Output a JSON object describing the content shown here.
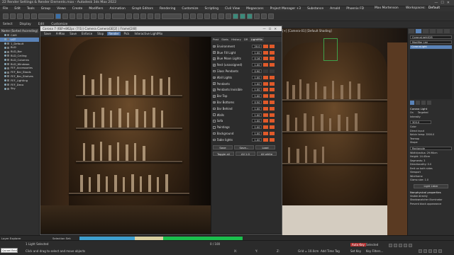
{
  "window": {
    "title": "22 Render Settings & Render Elements.max - Autodesk 3ds Max 2022"
  },
  "menubar": {
    "items": [
      "File",
      "Edit",
      "Tools",
      "Group",
      "Views",
      "Create",
      "Modifiers",
      "Animation",
      "Graph Editors",
      "Rendering",
      "Customize",
      "Scripting",
      "Civil View",
      "Megascans",
      "Project Manager +3",
      "Substance",
      "Arnold",
      "Phoenix FD"
    ],
    "workspace_user": "Max Mortenson",
    "workspaces_label": "Workspaces:",
    "workspace_value": "Default"
  },
  "toolbar2": {
    "items": [
      "Select",
      "Display",
      "Edit",
      "Customize"
    ]
  },
  "explorer": {
    "header": "Name (Sorted Ascending)",
    "items": [
      {
        "label": "CAM",
        "child": true,
        "selected": false
      },
      {
        "label": "LGT",
        "child": true,
        "selected": true
      },
      {
        "label": "1_Default",
        "child": true,
        "selected": false
      },
      {
        "label": "BLD",
        "child": true,
        "selected": false
      },
      {
        "label": "BLD_Bar",
        "child": true,
        "selected": false
      },
      {
        "label": "BLD_Ceiling",
        "child": true,
        "selected": false
      },
      {
        "label": "BLD_Columns",
        "child": true,
        "selected": false
      },
      {
        "label": "BLD_Windows",
        "child": true,
        "selected": false
      },
      {
        "label": "FEF_Accessories",
        "child": true,
        "selected": false
      },
      {
        "label": "FEF_Bar_Stools",
        "child": true,
        "selected": false
      },
      {
        "label": "FEF_Bar_Shelves",
        "child": true,
        "selected": false
      },
      {
        "label": "FEF_Lighting",
        "child": true,
        "selected": false
      },
      {
        "label": "FEF_Deco",
        "child": true,
        "selected": false
      },
      {
        "label": "Sky",
        "child": true,
        "selected": false
      }
    ]
  },
  "viewport": {
    "label": "[+] [Camera-01] [Default Shading]"
  },
  "framebuffer": {
    "title": "Corona 7 (6Ef+862pc (7/1)) Camera CameraGE[2] | Frame[2/8]",
    "tools": [
      "Save",
      "A-Max",
      "Save",
      "Enforce",
      "Stop",
      "Render",
      "Pick",
      "Interactive LightMix"
    ],
    "active_tool": "Render",
    "tabs": [
      "Post",
      "Stats",
      "History",
      "DR",
      "LightMix"
    ],
    "active_tab": "LightMix",
    "lightmix": [
      {
        "name": "Environment",
        "checked": true,
        "value": "20.0",
        "swatch": "on"
      },
      {
        "name": "Blue Fill Light",
        "checked": true,
        "value": "1.00",
        "swatch": "on"
      },
      {
        "name": "Blue Moon Lights",
        "checked": true,
        "value": "0.16",
        "swatch": "on"
      },
      {
        "name": "Rest (unassigned)",
        "checked": true,
        "value": "1.00",
        "swatch": "on"
      },
      {
        "name": "Glass Pendants",
        "checked": false,
        "value": "0.90",
        "swatch": "k"
      },
      {
        "name": "Wall Lights",
        "checked": true,
        "value": "1.00",
        "swatch": "on"
      },
      {
        "name": "Pendants",
        "checked": true,
        "value": "1.00",
        "swatch": "on"
      },
      {
        "name": "Pendants Invisible",
        "checked": true,
        "value": "1.00",
        "swatch": "on"
      },
      {
        "name": "Bar Top",
        "checked": true,
        "value": "1.00",
        "swatch": "on"
      },
      {
        "name": "Bar Bottoms",
        "checked": true,
        "value": "0.50",
        "swatch": "on"
      },
      {
        "name": "Bar Behind",
        "checked": false,
        "value": "1.00",
        "swatch": "on"
      },
      {
        "name": "Walls",
        "checked": false,
        "value": "1.00",
        "swatch": "on"
      },
      {
        "name": "Sofa",
        "checked": false,
        "value": "1.00",
        "swatch": "on"
      },
      {
        "name": "Paintings",
        "checked": false,
        "value": "1.00",
        "swatch": "on"
      },
      {
        "name": "Background",
        "checked": false,
        "value": "1.00",
        "swatch": "on"
      },
      {
        "name": "Table lights",
        "checked": false,
        "value": "1.00",
        "swatch": "on"
      }
    ],
    "save_row": [
      "Save",
      "Save...",
      "Load"
    ],
    "bottom_row": [
      "Toggle all",
      "All 1.0",
      "All white"
    ]
  },
  "cmdpanel": {
    "name_field": "CoronaLight028",
    "modifier_list": "Modifier List",
    "stack_item": "CoronaLight",
    "section_title": "Corona Light",
    "on_label": "On",
    "targeted_label": "Targeted",
    "intensity_label": "Intensity",
    "intensity_value": "300.0",
    "color_label": "Color",
    "direct_input": "Direct input",
    "kelvin_temp": "Kelvin temp: 3500.0",
    "texmap": "Texmap",
    "shape_label": "Shape",
    "shape_value": "Rectangle",
    "width_label": "Width/radius: 29.96cm",
    "height_label": "Height: 14.45cm",
    "segments": "Segments: 3",
    "directionality": "Directionality: 0.0",
    "emit_both": "Emit on both sides",
    "viewport_label": "Viewport",
    "wireframe": "Wireframe",
    "gizmo_size": "Gizmo size: 1.0",
    "light_lister": "Light Lister",
    "nonphysical": "Nonphysical properties",
    "visible_directly": "Visible directly",
    "shadowcatcher": "Shadowcatcher illuminator",
    "prevent_black": "Prevent black appearance"
  },
  "status": {
    "selection": "1 Light Selected",
    "hint": "Click and drag to select and move objects",
    "maxscript": "Quixel Bridge",
    "layer_explorer": "Layer Explorer",
    "selection_set": "Selection Set:",
    "frame_counter": "0 / 100",
    "add_time_tag": "Add Time Tag",
    "autokey": "Auto Key",
    "selected": "Selected",
    "setkey": "Set Key",
    "key_filters": "Key Filters...",
    "x_label": "X:",
    "y_label": "Y:",
    "z_label": "Z:",
    "grid": "Grid = 10.0cm"
  },
  "colors": {
    "accent": "#5a83b8",
    "lightmix_swatch": "#e05a2a",
    "timeline_green": "#1bbf4d",
    "timeline_cream": "#d9d0a0",
    "timeline_blue": "#3fa0d0"
  }
}
